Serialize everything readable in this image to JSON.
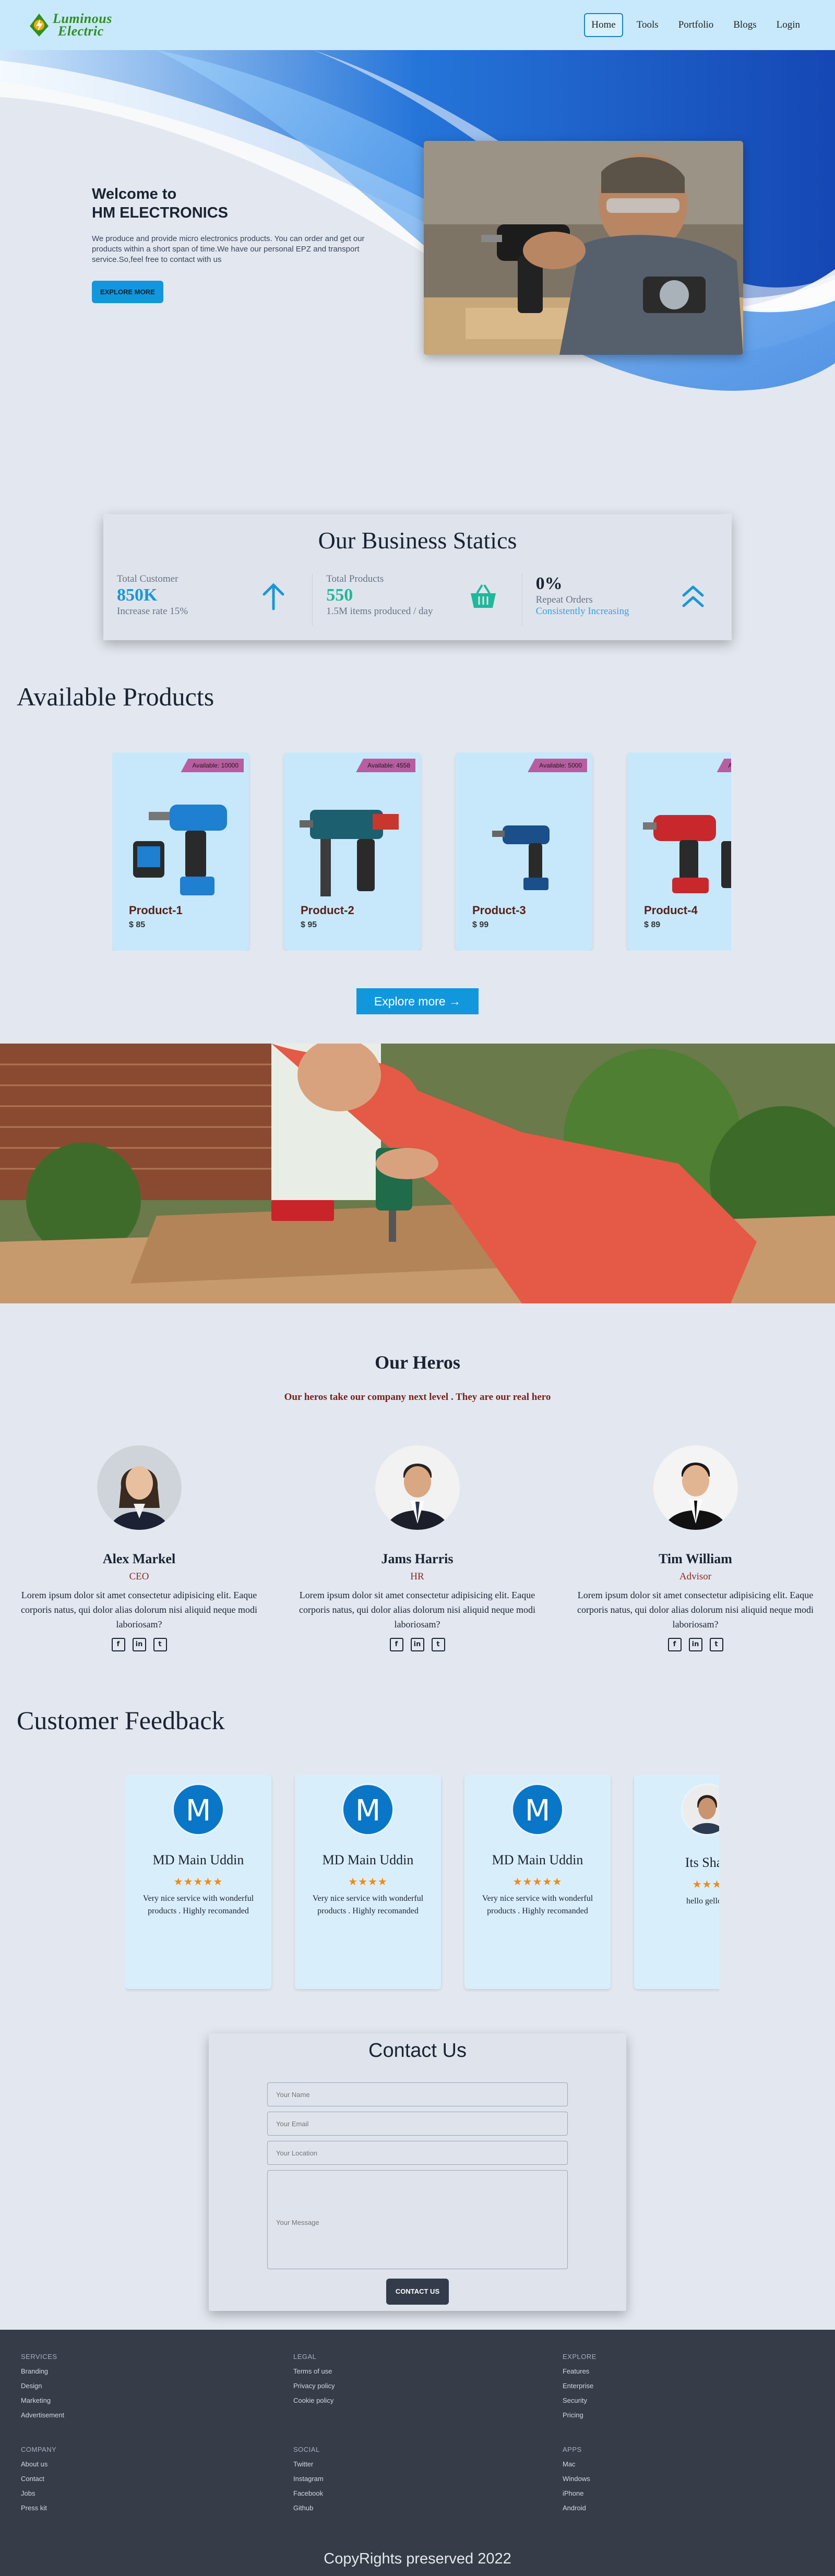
{
  "nav": {
    "logo_line1": "Luminous",
    "logo_line2": "Electric",
    "links": [
      "Home",
      "Tools",
      "Portfolio",
      "Blogs",
      "Login"
    ]
  },
  "hero": {
    "title_line1": "Welcome to",
    "title_line2": "HM ELECTRONICS",
    "description": "We produce and provide micro electronics products. You can order and get our products within a short span of time.We have our personal EPZ and transport service.So,feel free to contact with us",
    "button": "EXPLORE MORE"
  },
  "stats": {
    "title": "Our Business Statics",
    "items": [
      {
        "label": "Total Customer",
        "value": "850K",
        "sub": "Increase rate 15%",
        "icon": "arrow-up-icon"
      },
      {
        "label": "Total Products",
        "value": "550",
        "sub": "1.5M items produced / day",
        "icon": "basket-icon"
      },
      {
        "label": "0%",
        "value": "Repeat Orders",
        "sub": "Consistently Increasing",
        "icon": "double-chevron-up-icon"
      }
    ]
  },
  "products": {
    "heading": "Available Products",
    "items": [
      {
        "badge": "Available: 10000",
        "name": "Product-1",
        "price": "$ 85"
      },
      {
        "badge": "Available: 4558",
        "name": "Product-2",
        "price": "$ 95"
      },
      {
        "badge": "Available: 5000",
        "name": "Product-3",
        "price": "$ 99"
      },
      {
        "badge": "Available",
        "name": "Product-4",
        "price": "$ 89"
      }
    ],
    "explore_button": "Explore more →"
  },
  "team": {
    "title": "Our Heros",
    "subtitle": "Our heros take our company next level . They are our real hero",
    "members": [
      {
        "name": "Alex Markel",
        "role": "CEO",
        "bio": "Lorem ipsum dolor sit amet consectetur adipisicing elit. Eaque corporis natus, qui dolor alias dolorum nisi aliquid neque modi laboriosam?"
      },
      {
        "name": "Jams Harris",
        "role": "HR",
        "bio": "Lorem ipsum dolor sit amet consectetur adipisicing elit. Eaque corporis natus, qui dolor alias dolorum nisi aliquid neque modi laboriosam?"
      },
      {
        "name": "Tim William",
        "role": "Advisor",
        "bio": "Lorem ipsum dolor sit amet consectetur adipisicing elit. Eaque corporis natus, qui dolor alias dolorum nisi aliquid neque modi laboriosam?"
      }
    ]
  },
  "feedback": {
    "heading": "Customer Feedback",
    "items": [
      {
        "initial": "M",
        "name": "MD Main Uddin",
        "stars": "★★★★★",
        "text": "Very nice service with wonderful products . Highly recomanded"
      },
      {
        "initial": "M",
        "name": "MD Main Uddin",
        "stars": "★★★★",
        "text": "Very nice service with wonderful products . Highly recomanded"
      },
      {
        "initial": "M",
        "name": "MD Main Uddin",
        "stars": "★★★★★",
        "text": "Very nice service with wonderful products . Highly recomanded"
      },
      {
        "initial": "",
        "name": "Its Shak",
        "stars": "★★★",
        "text": "hello gello n"
      }
    ]
  },
  "contact": {
    "title": "Contact Us",
    "name_placeholder": "Your Name",
    "email_placeholder": "Your Email",
    "location_placeholder": "Your Location",
    "message_placeholder": "Your Message",
    "button": "CONTACT US"
  },
  "footer": {
    "columns": [
      {
        "heading": "SERVICES",
        "links": [
          "Branding",
          "Design",
          "Marketing",
          "Advertisement"
        ]
      },
      {
        "heading": "LEGAL",
        "links": [
          "Terms of use",
          "Privacy policy",
          "Cookie policy"
        ]
      },
      {
        "heading": "EXPLORE",
        "links": [
          "Features",
          "Enterprise",
          "Security",
          "Pricing"
        ]
      },
      {
        "heading": "COMPANY",
        "links": [
          "About us",
          "Contact",
          "Jobs",
          "Press kit"
        ]
      },
      {
        "heading": "SOCIAL",
        "links": [
          "Twitter",
          "Instagram",
          "Facebook",
          "Github"
        ]
      },
      {
        "heading": "APPS",
        "links": [
          "Mac",
          "Windows",
          "iPhone",
          "Android"
        ]
      }
    ],
    "copyright": "CopyRights preserved 2022"
  }
}
